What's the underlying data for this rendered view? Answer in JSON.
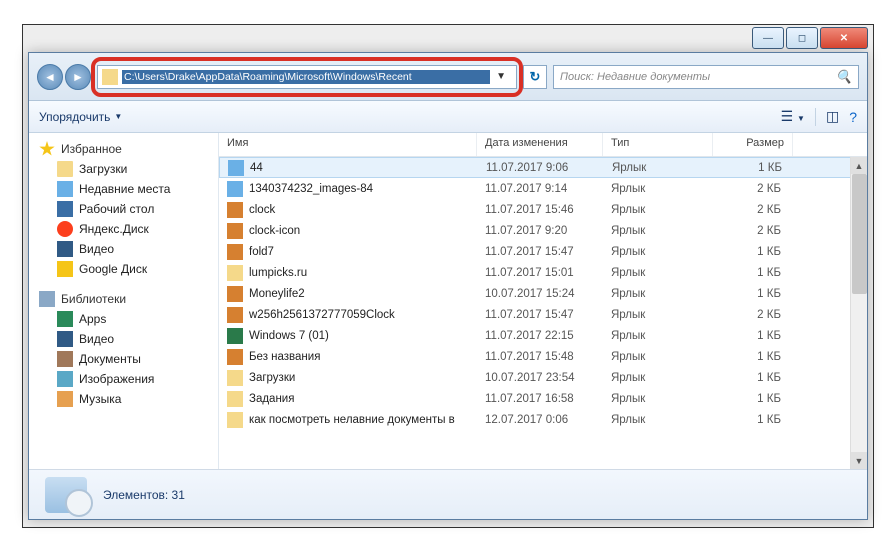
{
  "window": {
    "address_path": "C:\\Users\\Drake\\AppData\\Roaming\\Microsoft\\Windows\\Recent",
    "search_placeholder": "Поиск: Недавние документы",
    "organize_label": "Упорядочить",
    "status_text": "Элементов: 31",
    "titlebar_buttons": {
      "min": "—",
      "max": "◻",
      "close": "✕"
    }
  },
  "columns": {
    "name": "Имя",
    "date": "Дата изменения",
    "type": "Тип",
    "size": "Размер"
  },
  "sidebar": {
    "favorites": {
      "label": "Избранное",
      "items": [
        {
          "label": "Загрузки",
          "icon": "folder"
        },
        {
          "label": "Недавние места",
          "icon": "img"
        },
        {
          "label": "Рабочий стол",
          "icon": "desk"
        },
        {
          "label": "Яндекс.Диск",
          "icon": "ydisk"
        },
        {
          "label": "Видео",
          "icon": "video"
        },
        {
          "label": "Google Диск",
          "icon": "gdrive"
        }
      ]
    },
    "libraries": {
      "label": "Библиотеки",
      "items": [
        {
          "label": "Apps",
          "icon": "apps"
        },
        {
          "label": "Видео",
          "icon": "video"
        },
        {
          "label": "Документы",
          "icon": "doc"
        },
        {
          "label": "Изображения",
          "icon": "pic"
        },
        {
          "label": "Музыка",
          "icon": "music"
        }
      ]
    }
  },
  "files": [
    {
      "name": "44",
      "date": "11.07.2017 9:06",
      "type": "Ярлык",
      "size": "1 КБ",
      "icon": "img",
      "selected": true
    },
    {
      "name": "1340374232_images-84",
      "date": "11.07.2017 9:14",
      "type": "Ярлык",
      "size": "2 КБ",
      "icon": "img"
    },
    {
      "name": "clock",
      "date": "11.07.2017 15:46",
      "type": "Ярлык",
      "size": "2 КБ",
      "icon": "ico2"
    },
    {
      "name": "clock-icon",
      "date": "11.07.2017 9:20",
      "type": "Ярлык",
      "size": "2 КБ",
      "icon": "ico2"
    },
    {
      "name": "fold7",
      "date": "11.07.2017 15:47",
      "type": "Ярлык",
      "size": "1 КБ",
      "icon": "ico2"
    },
    {
      "name": "lumpicks.ru",
      "date": "11.07.2017 15:01",
      "type": "Ярлык",
      "size": "1 КБ",
      "icon": "folder"
    },
    {
      "name": "Moneylife2",
      "date": "10.07.2017 15:24",
      "type": "Ярлык",
      "size": "1 КБ",
      "icon": "ico2"
    },
    {
      "name": "w256h2561372777059Clock",
      "date": "11.07.2017 15:47",
      "type": "Ярлык",
      "size": "2 КБ",
      "icon": "ico2"
    },
    {
      "name": "Windows 7 (01)",
      "date": "11.07.2017 22:15",
      "type": "Ярлык",
      "size": "1 КБ",
      "icon": "xls"
    },
    {
      "name": "Без названия",
      "date": "11.07.2017 15:48",
      "type": "Ярлык",
      "size": "1 КБ",
      "icon": "ico2"
    },
    {
      "name": "Загрузки",
      "date": "10.07.2017 23:54",
      "type": "Ярлык",
      "size": "1 КБ",
      "icon": "folder"
    },
    {
      "name": "Задания",
      "date": "11.07.2017 16:58",
      "type": "Ярлык",
      "size": "1 КБ",
      "icon": "folder"
    },
    {
      "name": "как посмотреть нелавние документы в",
      "date": "12.07.2017 0:06",
      "type": "Ярлык",
      "size": "1 КБ",
      "icon": "folder"
    }
  ]
}
